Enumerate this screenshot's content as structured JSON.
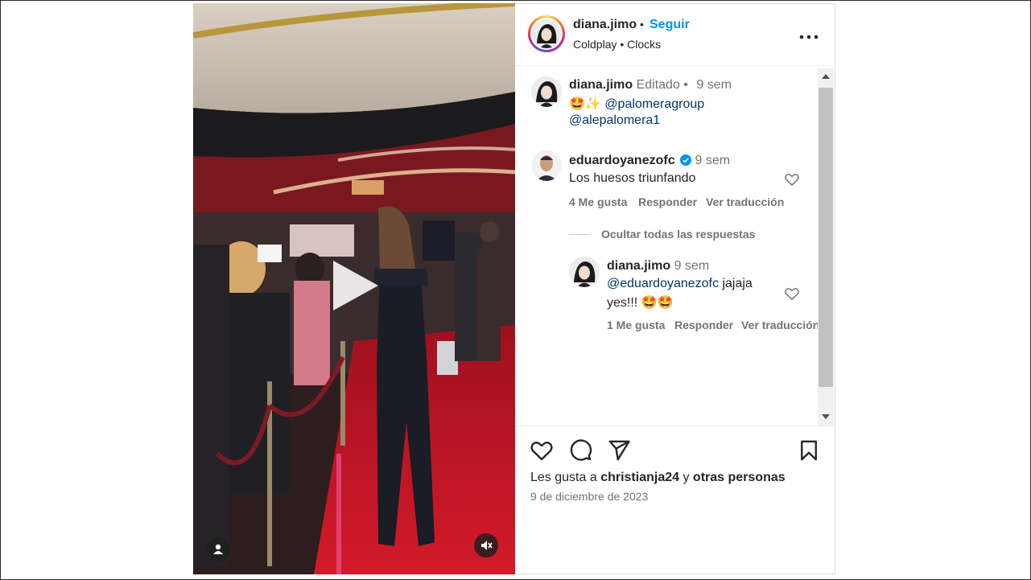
{
  "post": {
    "author": "diana.jimo",
    "separator": "•",
    "follow_label": "Seguir",
    "music_artist": "Coldplay",
    "music_dot": "•",
    "music_song": "Clocks"
  },
  "caption": {
    "author": "diana.jimo",
    "edited": "Editado",
    "dot": "•",
    "time": "9 sem",
    "emojis": "🤩✨",
    "mention1": "@palomeragroup",
    "mention2": "@alepalomera1"
  },
  "comment": {
    "author": "eduardoyanezofc",
    "verified_icon": "verified-badge-icon",
    "time": "9 sem",
    "text": "Los huesos triunfando",
    "likes": "4 Me gusta",
    "reply": "Responder",
    "translate": "Ver traducción",
    "hide_replies": "Ocultar todas las respuestas"
  },
  "reply": {
    "author": "diana.jimo",
    "time": "9 sem",
    "mention": "@eduardoyanezofc",
    "text_rest": " jajaja",
    "text_line2": "yes!!! 🤩🤩",
    "likes": "1 Me gusta",
    "reply": "Responder",
    "translate": "Ver traducción"
  },
  "footer": {
    "likes_prefix": "Les gusta a",
    "likes_user": "christianja24",
    "likes_and": "y",
    "likes_others": "otras personas",
    "date": "9 de diciembre de 2023"
  },
  "icons": {
    "like": "heart-icon",
    "comment": "comment-icon",
    "share": "share-icon",
    "save": "bookmark-icon",
    "more": "more-options-icon",
    "play": "play-icon",
    "mute": "muted-audio-icon",
    "tag": "user-tag-icon"
  },
  "colors": {
    "accent": "#0095f6",
    "mention": "#00376b",
    "muted": "#737373"
  }
}
